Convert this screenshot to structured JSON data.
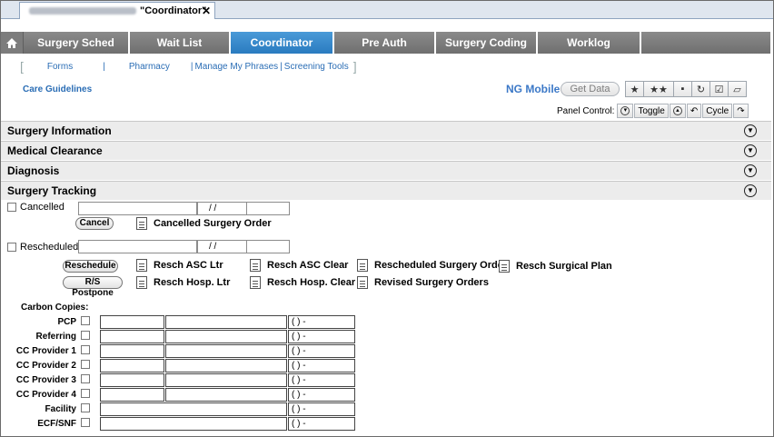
{
  "window": {
    "tab_title": "\"Coordinator\"",
    "close_glyph": "✕"
  },
  "main_nav": {
    "home_icon": "home-icon",
    "tabs": [
      {
        "label": "Surgery Sched",
        "active": false
      },
      {
        "label": "Wait List",
        "active": false
      },
      {
        "label": "Coordinator",
        "active": true
      },
      {
        "label": "Pre Auth",
        "active": false
      },
      {
        "label": "Surgery Coding",
        "active": false
      },
      {
        "label": "Worklog",
        "active": false
      }
    ]
  },
  "sub_links": [
    "Forms",
    "Pharmacy",
    "Manage My Phrases",
    "Screening Tools"
  ],
  "care_guidelines": "Care Guidelines",
  "ng_mobile": "NG Mobile",
  "get_data": "Get Data",
  "panel_control": {
    "label": "Panel Control:",
    "toggle": "Toggle",
    "cycle": "Cycle"
  },
  "panels": [
    {
      "title": "Surgery Information"
    },
    {
      "title": "Medical Clearance"
    },
    {
      "title": "Diagnosis"
    },
    {
      "title": "Surgery Tracking"
    }
  ],
  "tracking": {
    "cancelled_label": "Cancelled",
    "cancel_button": "Cancel",
    "cancelled_order": "Cancelled Surgery Order",
    "date_placeholder": "/ /",
    "rescheduled_label": "Rescheduled",
    "reschedule_button": "Reschedule",
    "postpone_button": "R/S Postpone",
    "links_row1": [
      "Resch ASC Ltr",
      "Resch ASC Clear",
      "Rescheduled Surgery Order",
      "Resch Surgical Plan"
    ],
    "links_row2": [
      "Resch Hosp. Ltr",
      "Resch Hosp. Clear",
      "Revised Surgery Orders"
    ]
  },
  "carbon_copies": {
    "title": "Carbon Copies:",
    "phone_placeholder": "(  )  -",
    "rows": [
      {
        "label": "PCP",
        "split": true
      },
      {
        "label": "Referring",
        "split": true
      },
      {
        "label": "CC Provider 1",
        "split": true
      },
      {
        "label": "CC Provider 2",
        "split": true
      },
      {
        "label": "CC Provider 3",
        "split": true
      },
      {
        "label": "CC Provider 4",
        "split": true
      },
      {
        "label": "Facility",
        "split": false
      },
      {
        "label": "ECF/SNF",
        "split": false
      }
    ]
  }
}
